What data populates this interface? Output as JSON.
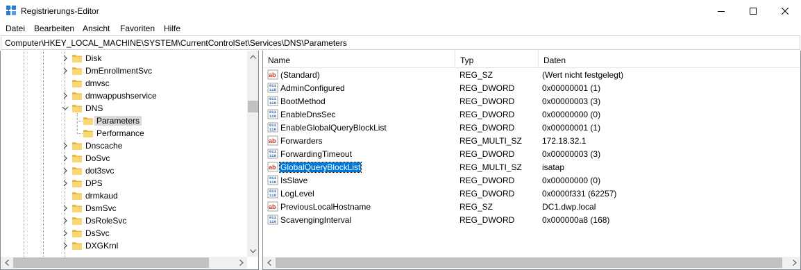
{
  "window": {
    "title": "Registrierungs-Editor",
    "icon": "regedit-icon"
  },
  "menu": [
    "Datei",
    "Bearbeiten",
    "Ansicht",
    "Favoriten",
    "Hilfe"
  ],
  "address": "Computer\\HKEY_LOCAL_MACHINE\\SYSTEM\\CurrentControlSet\\Services\\DNS\\Parameters",
  "tree": {
    "items": [
      {
        "label": "Disk",
        "level": 1,
        "expander": "collapsed"
      },
      {
        "label": "DmEnrollmentSvc",
        "level": 1,
        "expander": "collapsed"
      },
      {
        "label": "dmvsc",
        "level": 1,
        "expander": "none"
      },
      {
        "label": "dmwappushservice",
        "level": 1,
        "expander": "collapsed"
      },
      {
        "label": "DNS",
        "level": 1,
        "expander": "expanded"
      },
      {
        "label": "Parameters",
        "level": 2,
        "expander": "none",
        "selected": true
      },
      {
        "label": "Performance",
        "level": 2,
        "expander": "none"
      },
      {
        "label": "Dnscache",
        "level": 1,
        "expander": "collapsed"
      },
      {
        "label": "DoSvc",
        "level": 1,
        "expander": "collapsed"
      },
      {
        "label": "dot3svc",
        "level": 1,
        "expander": "collapsed"
      },
      {
        "label": "DPS",
        "level": 1,
        "expander": "collapsed"
      },
      {
        "label": "drmkaud",
        "level": 1,
        "expander": "none"
      },
      {
        "label": "DsmSvc",
        "level": 1,
        "expander": "collapsed"
      },
      {
        "label": "DsRoleSvc",
        "level": 1,
        "expander": "collapsed"
      },
      {
        "label": "DsSvc",
        "level": 1,
        "expander": "collapsed"
      },
      {
        "label": "DXGKrnl",
        "level": 1,
        "expander": "collapsed"
      }
    ]
  },
  "columns": {
    "name": "Name",
    "type": "Typ",
    "data": "Daten"
  },
  "values": [
    {
      "icon": "string",
      "name": "(Standard)",
      "type": "REG_SZ",
      "data": "(Wert nicht festgelegt)"
    },
    {
      "icon": "binary",
      "name": "AdminConfigured",
      "type": "REG_DWORD",
      "data": "0x00000001 (1)"
    },
    {
      "icon": "binary",
      "name": "BootMethod",
      "type": "REG_DWORD",
      "data": "0x00000003 (3)"
    },
    {
      "icon": "binary",
      "name": "EnableDnsSec",
      "type": "REG_DWORD",
      "data": "0x00000000 (0)"
    },
    {
      "icon": "binary",
      "name": "EnableGlobalQueryBlockList",
      "type": "REG_DWORD",
      "data": "0x00000001 (1)"
    },
    {
      "icon": "string",
      "name": "Forwarders",
      "type": "REG_MULTI_SZ",
      "data": "172.18.32.1"
    },
    {
      "icon": "binary",
      "name": "ForwardingTimeout",
      "type": "REG_DWORD",
      "data": "0x00000003 (3)"
    },
    {
      "icon": "string",
      "name": "GlobalQueryBlockList",
      "type": "REG_MULTI_SZ",
      "data": "isatap",
      "selected": true
    },
    {
      "icon": "binary",
      "name": "IsSlave",
      "type": "REG_DWORD",
      "data": "0x00000000 (0)"
    },
    {
      "icon": "binary",
      "name": "LogLevel",
      "type": "REG_DWORD",
      "data": "0x0000f331 (62257)"
    },
    {
      "icon": "string",
      "name": "PreviousLocalHostname",
      "type": "REG_SZ",
      "data": "DC1.dwp.local"
    },
    {
      "icon": "binary",
      "name": "ScavengingInterval",
      "type": "REG_DWORD",
      "data": "0x000000a8 (168)"
    }
  ],
  "colors": {
    "selection": "#0078d7",
    "tree_selection": "#d9d9d9",
    "folder": "#f8d775"
  }
}
